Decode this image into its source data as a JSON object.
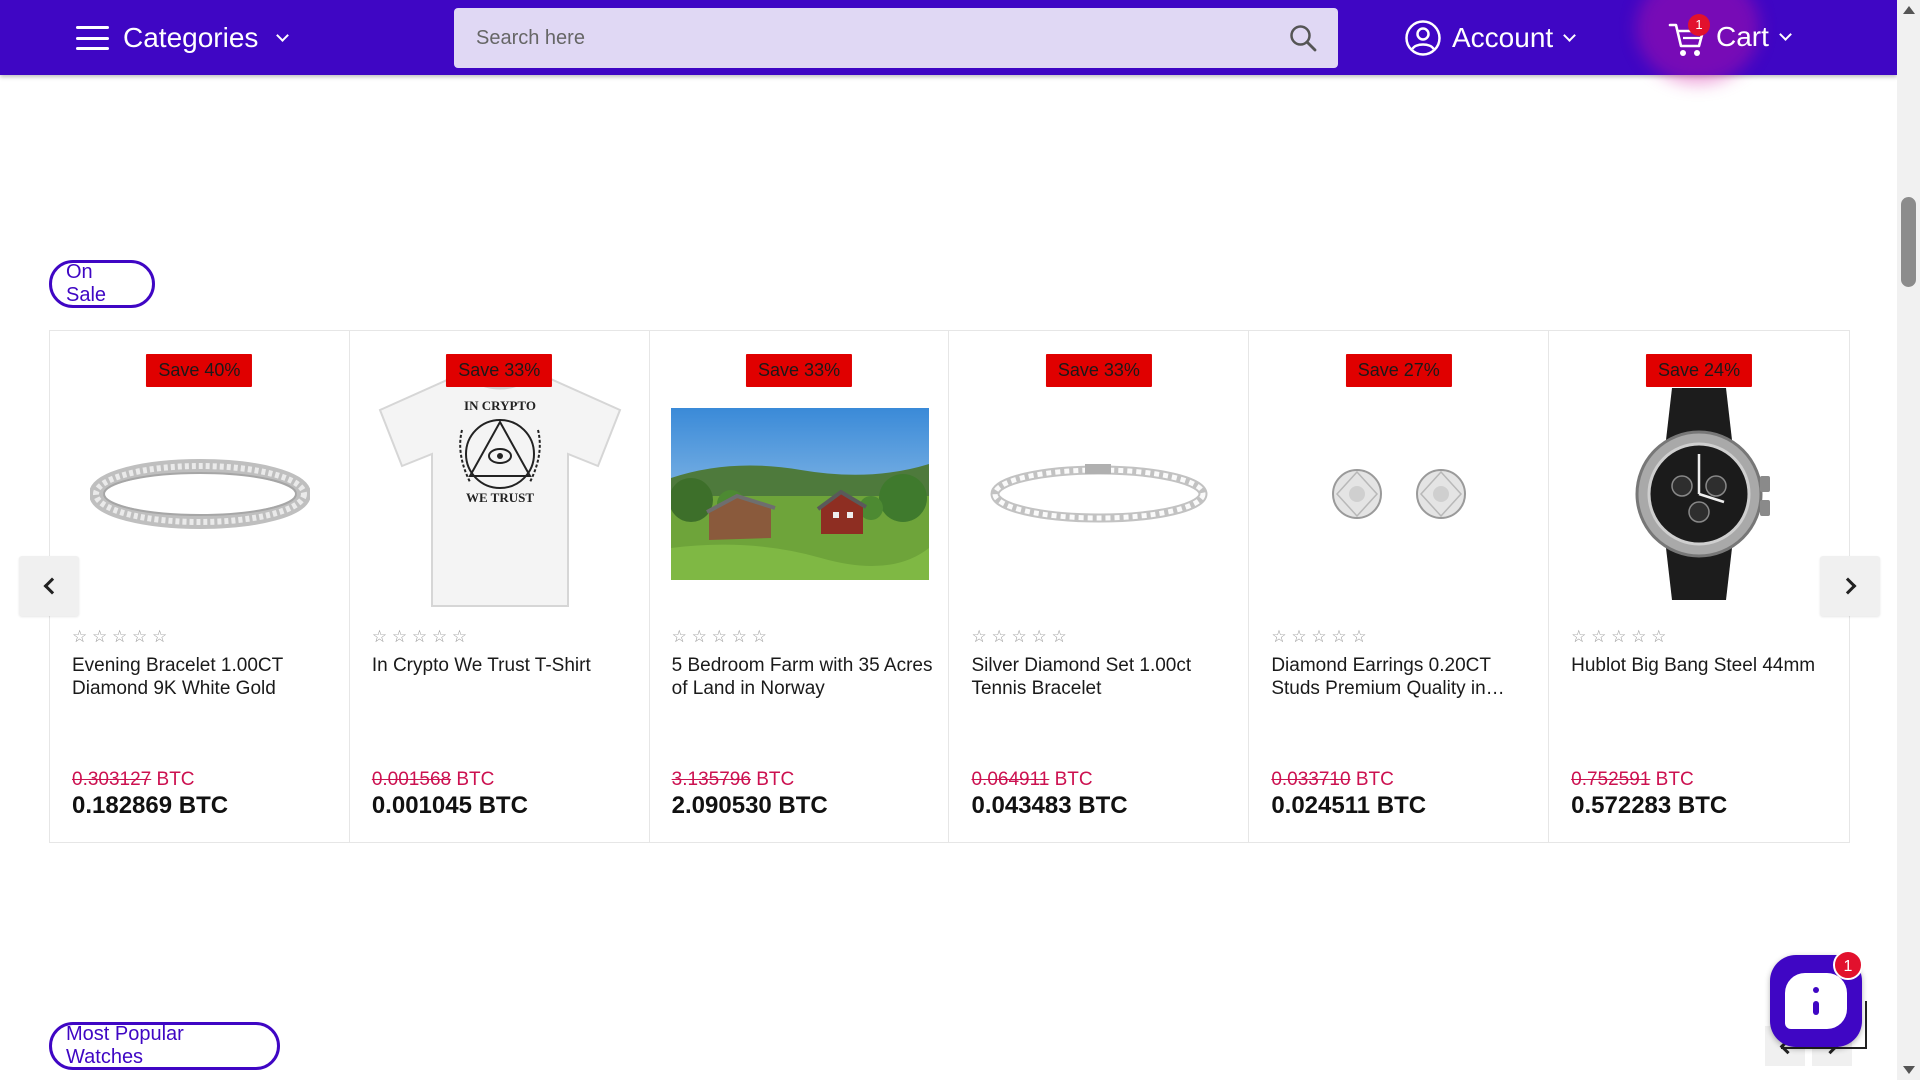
{
  "header": {
    "categories_label": "Categories",
    "search_placeholder": "Search here",
    "account_label": "Account",
    "cart_label": "Cart",
    "cart_count": "1"
  },
  "sections": {
    "on_sale_label": "On Sale",
    "watches_label": "Most Popular Watches"
  },
  "products": [
    {
      "badge": "Save 40%",
      "image": "bracelet-image",
      "title": "Evening Bracelet 1.00CT Diamond 9K White Gold",
      "old_price": "0.303127",
      "new_price": "0.182869 BTC",
      "currency": "BTC",
      "rating": 0
    },
    {
      "badge": "Save 33%",
      "image": "tshirt-image",
      "title": "In Crypto We Trust T-Shirt",
      "old_price": "0.001568",
      "new_price": "0.001045 BTC",
      "currency": "BTC",
      "rating": 0
    },
    {
      "badge": "Save 33%",
      "image": "farm-image",
      "title": "5 Bedroom Farm with 35 Acres of Land in Norway",
      "old_price": "3.135796",
      "new_price": "2.090530 BTC",
      "currency": "BTC",
      "rating": 0
    },
    {
      "badge": "Save 33%",
      "image": "tennis-bracelet-image",
      "title": "Silver Diamond Set 1.00ct Tennis Bracelet",
      "old_price": "0.064911",
      "new_price": "0.043483 BTC",
      "currency": "BTC",
      "rating": 0
    },
    {
      "badge": "Save 27%",
      "image": "earrings-image",
      "title": "Diamond Earrings 0.20CT Studs Premium Quality in…",
      "old_price": "0.033710",
      "new_price": "0.024511 BTC",
      "currency": "BTC",
      "rating": 0
    },
    {
      "badge": "Save 24%",
      "image": "watch-image",
      "title": "Hublot Big Bang Steel 44mm",
      "old_price": "0.752591",
      "new_price": "0.572283 BTC",
      "currency": "BTC",
      "rating": 0
    }
  ],
  "tshirt_print": {
    "line1": "IN CRYPTO",
    "line2": "WE TRUST"
  },
  "chat": {
    "badge_count": "1"
  },
  "colors": {
    "brand": "#3f06c4",
    "sale_badge": "#e00000",
    "old_price": "#cc1150",
    "notification": "#e2112d"
  }
}
